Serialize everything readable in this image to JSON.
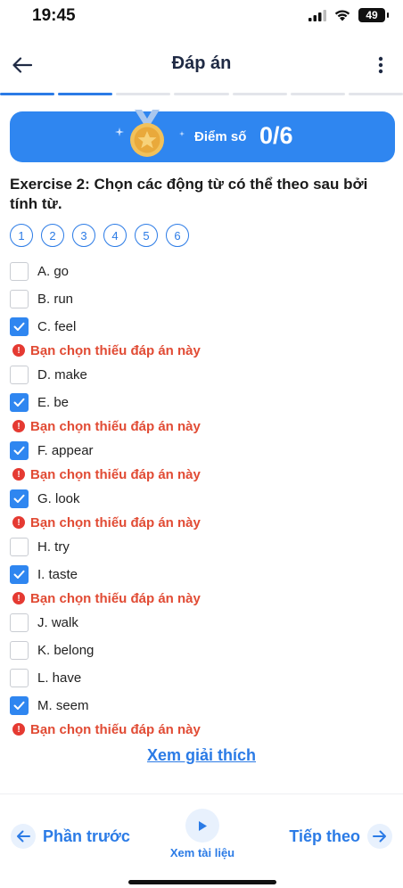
{
  "status": {
    "time": "19:45",
    "battery": "49"
  },
  "header": {
    "title": "Đáp án"
  },
  "progress": {
    "segments": 7,
    "active": 2
  },
  "score": {
    "label": "Điểm số",
    "value": "0/6"
  },
  "question": "Exercise 2: Chọn các động từ có thể theo sau bởi tính từ.",
  "question_numbers": [
    "1",
    "2",
    "3",
    "4",
    "5",
    "6"
  ],
  "options": [
    {
      "label": "A. go",
      "checked": false,
      "warning": ""
    },
    {
      "label": "B. run",
      "checked": false,
      "warning": ""
    },
    {
      "label": "C. feel",
      "checked": true,
      "warning": "Bạn chọn thiếu đáp án này"
    },
    {
      "label": "D. make",
      "checked": false,
      "warning": ""
    },
    {
      "label": "E. be",
      "checked": true,
      "warning": "Bạn chọn thiếu đáp án này"
    },
    {
      "label": "F. appear",
      "checked": true,
      "warning": "Bạn chọn thiếu đáp án này"
    },
    {
      "label": "G. look",
      "checked": true,
      "warning": "Bạn chọn thiếu đáp án này"
    },
    {
      "label": "H. try",
      "checked": false,
      "warning": ""
    },
    {
      "label": "I. taste",
      "checked": true,
      "warning": "Bạn chọn thiếu đáp án này"
    },
    {
      "label": "J. walk",
      "checked": false,
      "warning": ""
    },
    {
      "label": "K. belong",
      "checked": false,
      "warning": ""
    },
    {
      "label": "L. have",
      "checked": false,
      "warning": ""
    },
    {
      "label": "M. seem",
      "checked": true,
      "warning": "Bạn chọn thiếu đáp án này"
    }
  ],
  "explain_link": "Xem giải thích",
  "bottom_nav": {
    "prev": "Phần trước",
    "docs": "Xem tài liệu",
    "next": "Tiếp theo"
  },
  "colors": {
    "accent": "#2f86f0",
    "warning": "#e14b34"
  }
}
